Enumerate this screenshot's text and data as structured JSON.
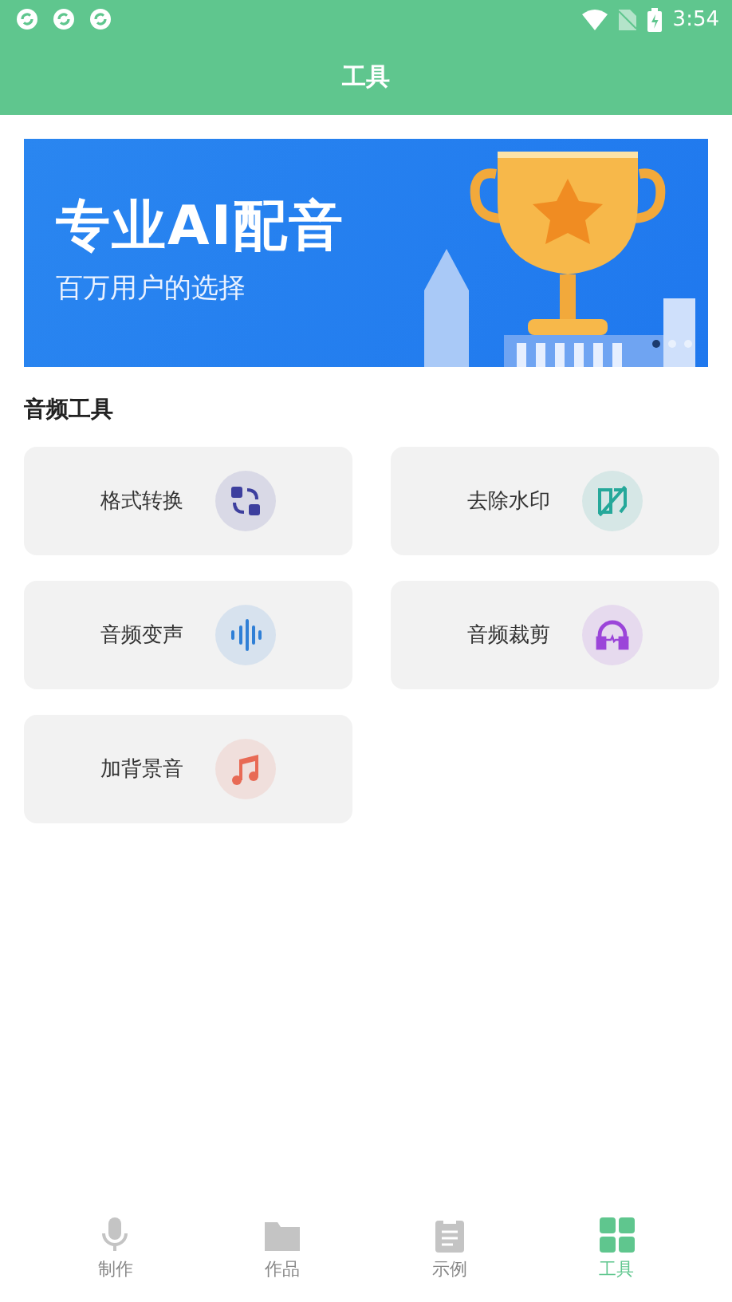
{
  "status_bar": {
    "time": "3:54"
  },
  "header": {
    "title": "工具"
  },
  "banner": {
    "headline": "专业AI配音",
    "subline": "百万用户的选择",
    "dots": [
      {
        "selected": true
      },
      {
        "selected": false
      },
      {
        "selected": false
      }
    ]
  },
  "section": {
    "title": "音频工具"
  },
  "tools": [
    {
      "label": "格式转换",
      "kind": "convert",
      "color": "#3d3f9e"
    },
    {
      "label": "去除水印",
      "kind": "watermark",
      "color": "#25a89a"
    },
    {
      "label": "音频变声",
      "kind": "voice",
      "color": "#2f7fd6"
    },
    {
      "label": "音频裁剪",
      "kind": "trim",
      "color": "#9b45d9"
    },
    {
      "label": "加背景音",
      "kind": "music",
      "color": "#e86a55"
    }
  ],
  "tabs": [
    {
      "label": "制作",
      "kind": "mic",
      "selected": false
    },
    {
      "label": "作品",
      "kind": "folder",
      "selected": false
    },
    {
      "label": "示例",
      "kind": "clipboard",
      "selected": false
    },
    {
      "label": "工具",
      "kind": "grid",
      "selected": true
    }
  ]
}
